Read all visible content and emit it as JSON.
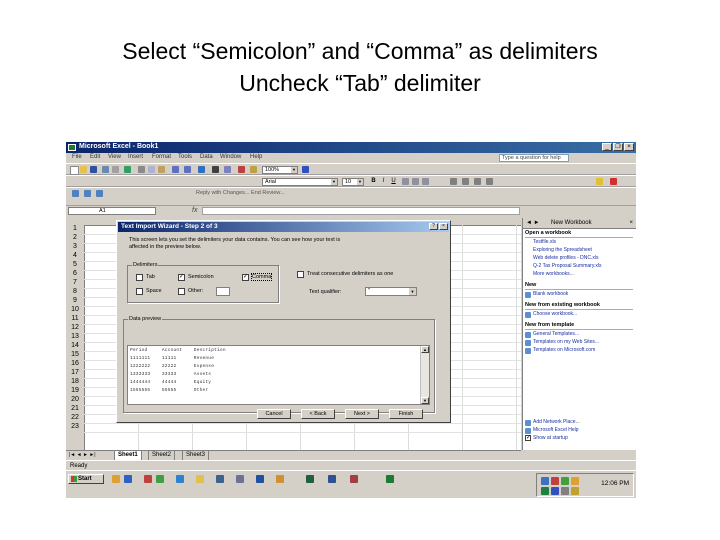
{
  "slide": {
    "line1": "Select “Semicolon” and “Comma” as delimiters",
    "line2": "Uncheck “Tab” delimiter"
  },
  "window": {
    "title": "Microsoft Excel - Book1"
  },
  "menu": {
    "items": [
      "File",
      "Edit",
      "View",
      "Insert",
      "Format",
      "Tools",
      "Data",
      "Window",
      "Help"
    ],
    "ask_placeholder": "Type a question for help"
  },
  "toolbar": {
    "font": "Arial",
    "size": "10",
    "zoom": "100%",
    "review_text": "Reply with Changes...  End Review..."
  },
  "formula": {
    "cell": "A1",
    "fx": "fx"
  },
  "grid": {
    "rows": [
      "1",
      "2",
      "3",
      "4",
      "5",
      "6",
      "7",
      "8",
      "9",
      "10",
      "11",
      "12",
      "13",
      "14",
      "15",
      "16",
      "17",
      "18",
      "19",
      "20",
      "21",
      "22",
      "23"
    ]
  },
  "dialog": {
    "title": "Text Import Wizard - Step 2 of 3",
    "help": "?",
    "close": "×",
    "description": "This screen lets you set the delimiters your data contains. You can see how your text is affected in the preview below.",
    "delimiters_label": "Delimiters",
    "tab": {
      "label": "Tab",
      "checked": false
    },
    "semicolon": {
      "label": "Semicolon",
      "checked": true
    },
    "comma": {
      "label": "Comma",
      "checked": true
    },
    "space": {
      "label": "Space",
      "checked": false
    },
    "other": {
      "label": "Other:",
      "checked": false
    },
    "consecutive": {
      "label": "Treat consecutive delimiters as one",
      "checked": false
    },
    "qualifier_label": "Text qualifier:",
    "qualifier_value": "\"",
    "preview_label": "Data preview",
    "preview_rows": [
      "Period     Account    Description",
      "1111111    11111      Revenue",
      "1222222    22222      Expense",
      "1333333    33333      Assets",
      "1444444    44444      Equity",
      "1555555    55555      Other"
    ],
    "cancel": "Cancel",
    "back": "< Back",
    "next": "Next >",
    "finish": "Finish"
  },
  "sheet_tabs": {
    "nav": "|◄ ◄ ► ►|",
    "tabs": [
      "Sheet1",
      "Sheet2",
      "Sheet3"
    ]
  },
  "taskpane": {
    "title": "New Workbook",
    "nav": "◄ ►",
    "close": "×",
    "sections": [
      {
        "title": "Open a workbook",
        "links": [
          "Testfile.xls",
          "Exploring the Spreadsheet",
          "Web delete profiles - DNC.xls",
          "Q-2 Tax Proposal Summary.xls",
          "More workbooks..."
        ]
      },
      {
        "title": "New",
        "links": [
          "Blank workbook"
        ]
      },
      {
        "title": "New from existing workbook",
        "links": [
          "Choose workbook..."
        ]
      },
      {
        "title": "New from template",
        "links": [
          "General Templates...",
          "Templates on my Web Sites...",
          "Templates on Microsoft.com"
        ]
      }
    ],
    "bottom_links": [
      "Add Network Place...",
      "Microsoft Excel Help",
      "Show at startup"
    ]
  },
  "status": {
    "text": "Ready"
  },
  "taskbar": {
    "start": "Start",
    "clock": "12:06 PM"
  },
  "colors": {
    "titlebar": "#0a246a",
    "face": "#d4d0c8",
    "link": "#1a2ea0"
  }
}
